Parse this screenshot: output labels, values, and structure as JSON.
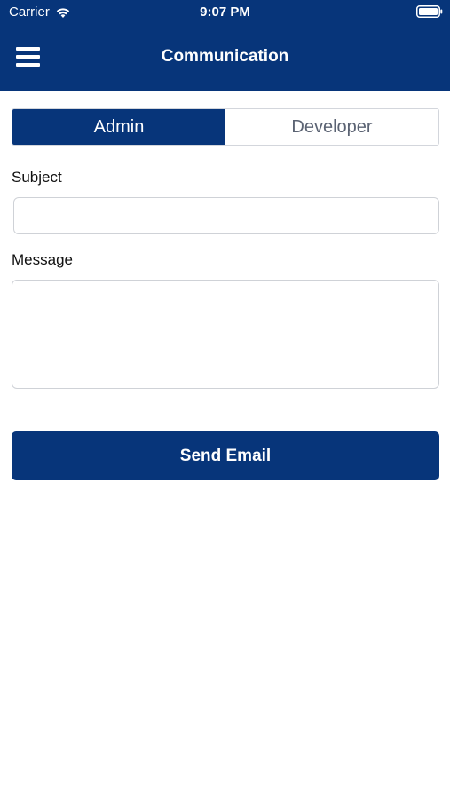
{
  "status_bar": {
    "carrier": "Carrier",
    "time": "9:07 PM",
    "wifi_icon": "wifi-icon",
    "battery_icon": "battery-icon"
  },
  "nav": {
    "title": "Communication",
    "menu_icon": "hamburger-menu-icon"
  },
  "recipient_tabs": {
    "selected": "Admin",
    "options": [
      "Admin",
      "Developer"
    ]
  },
  "form": {
    "subject_label": "Subject",
    "subject_value": "",
    "message_label": "Message",
    "message_value": "",
    "submit_label": "Send Email"
  },
  "colors": {
    "primary": "#07357a",
    "background": "#ffffff",
    "inactive_tab_text": "#5b6373",
    "field_border": "#cfd2d7"
  }
}
